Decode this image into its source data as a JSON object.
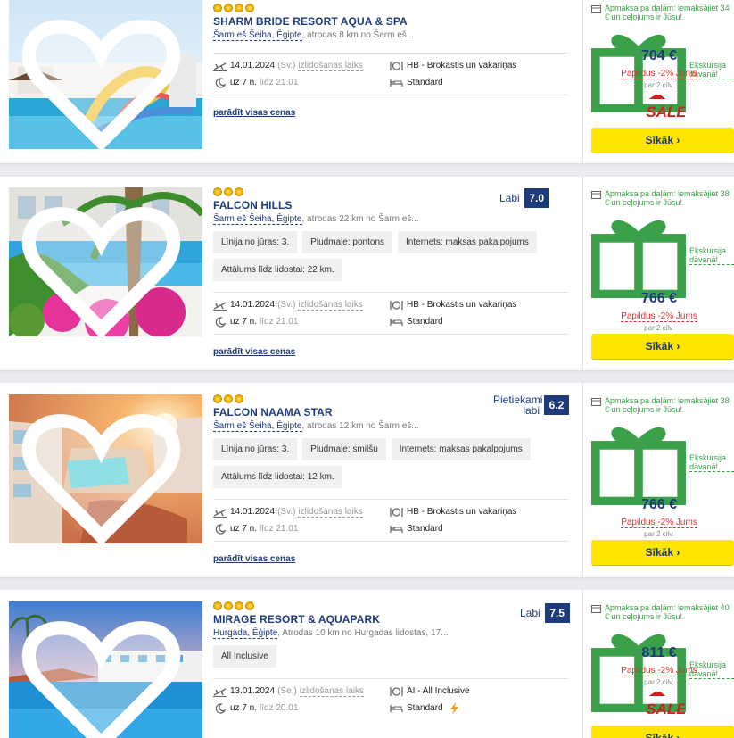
{
  "hotels": [
    {
      "name": "SHARM BRIDE RESORT AQUA & SPA",
      "stars": 4,
      "place": "Šarm eš Šeiha, Ēģipte",
      "distance": ", atrodas 8 km no Šarm eš...",
      "rating_label": "",
      "rating_score": "",
      "tags": [],
      "depart_date": "14.01.2024",
      "depart_day": "(Sv.)",
      "depart_label": "izlidošanas laiks",
      "nights": "uz 7 n.",
      "return_label": "līdz 21.01",
      "meal": "HB - Brokastis un vakariņas",
      "room": "Standard",
      "all_prices": "parādīt visas cenas",
      "promo": "Apmaksa pa daļām: iemaksājiet 34 € un ceļojums ir Jūsu!",
      "gift": "Ekskursija dāvanā!",
      "price": "704 €",
      "discount": "Papildus -2% Jums",
      "per": "par 2 cilv.",
      "sale": true,
      "button": "Sīkāk ›"
    },
    {
      "name": "FALCON HILLS",
      "stars": 3,
      "place": "Šarm eš Šeiha, Ēģipte",
      "distance": ", atrodas 22 km no Šarm eš...",
      "rating_label": "Labi",
      "rating_score": "7.0",
      "tags": [
        "Līnija no jūras: 3.",
        "Pludmale: pontons",
        "Internets: maksas pakalpojums",
        "Attālums līdz lidostai: 22 km."
      ],
      "depart_date": "14.01.2024",
      "depart_day": "(Sv.)",
      "depart_label": "izlidošanas laiks",
      "nights": "uz 7 n.",
      "return_label": "līdz 21.01",
      "meal": "HB - Brokastis un vakariņas",
      "room": "Standard",
      "all_prices": "parādīt visas cenas",
      "promo": "Apmaksa pa daļām: iemaksājiet 38 € un ceļojums ir Jūsu!",
      "gift": "Ekskursija dāvanā!",
      "price": "766 €",
      "discount": "Papildus -2% Jums",
      "per": "par 2 cilv.",
      "sale": false,
      "button": "Sīkāk ›"
    },
    {
      "name": "FALCON NAAMA STAR",
      "stars": 3,
      "place": "Šarm eš Šeiha, Ēģipte",
      "distance": ", atrodas 12 km no Šarm eš...",
      "rating_label": "Pietiekami labi",
      "rating_score": "6.2",
      "tags": [
        "Līnija no jūras: 3.",
        "Pludmale: smilšu",
        "Internets: maksas pakalpojums",
        "Attālums līdz lidostai: 12 km."
      ],
      "depart_date": "14.01.2024",
      "depart_day": "(Sv.)",
      "depart_label": "izlidošanas laiks",
      "nights": "uz 7 n.",
      "return_label": "līdz 21.01",
      "meal": "HB - Brokastis un vakariņas",
      "room": "Standard",
      "all_prices": "parādīt visas cenas",
      "promo": "Apmaksa pa daļām: iemaksājiet 38 € un ceļojums ir Jūsu!",
      "gift": "Ekskursija dāvanā!",
      "price": "766 €",
      "discount": "Papildus -2% Jums",
      "per": "par 2 cilv.",
      "sale": false,
      "button": "Sīkāk ›"
    },
    {
      "name": "MIRAGE RESORT & AQUAPARK",
      "stars": 4,
      "place": "Hurgada, Ēģipte",
      "distance": ", Atrodas 10 km no Hurgadas lidostas, 17...",
      "rating_label": "Labi",
      "rating_score": "7.5",
      "tags": [
        "All Inclusive"
      ],
      "depart_date": "13.01.2024",
      "depart_day": "(Se.)",
      "depart_label": "izlidošanas laiks",
      "nights": "uz 7 n.",
      "return_label": "līdz 20.01",
      "meal": "AI - All Inclusive",
      "room": "Standard",
      "all_prices": "",
      "promo": "Apmaksa pa daļām: iemaksājiet 40 € un ceļojums ir Jūsu!",
      "gift": "Ekskursija dāvanā!",
      "price": "811 €",
      "discount": "Papildus -2% Jums",
      "per": "par 2 cilv.",
      "sale": true,
      "button": "Sīkāk ›"
    }
  ],
  "colors": {
    "brand": "#1d3a7a",
    "button": "#ffe500",
    "promo": "#3aa14a",
    "discount": "#e03030"
  },
  "icons": [
    "heart-icon",
    "plane-icon",
    "moon-icon",
    "meal-icon",
    "bed-icon",
    "wallet-icon",
    "gift-icon",
    "lightning-icon",
    "sale-badge"
  ]
}
